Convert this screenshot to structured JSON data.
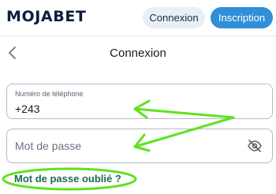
{
  "header": {
    "logo": "MOJABET",
    "login_label": "Connexion",
    "signup_label": "Inscription"
  },
  "page": {
    "title": "Connexion"
  },
  "form": {
    "phone_label": "Numéro de téléphone",
    "phone_value": "+243",
    "password_placeholder": "Mot de passe",
    "forgot_label": "Mot de passe oublié ?"
  },
  "icons": {
    "back": "chevron-left-icon",
    "password_toggle": "eye-off-icon"
  },
  "colors": {
    "brand": "#0a1e3c",
    "primary": "#2f8fd8",
    "link": "#1d6b52",
    "annotation": "#5fe21d"
  }
}
